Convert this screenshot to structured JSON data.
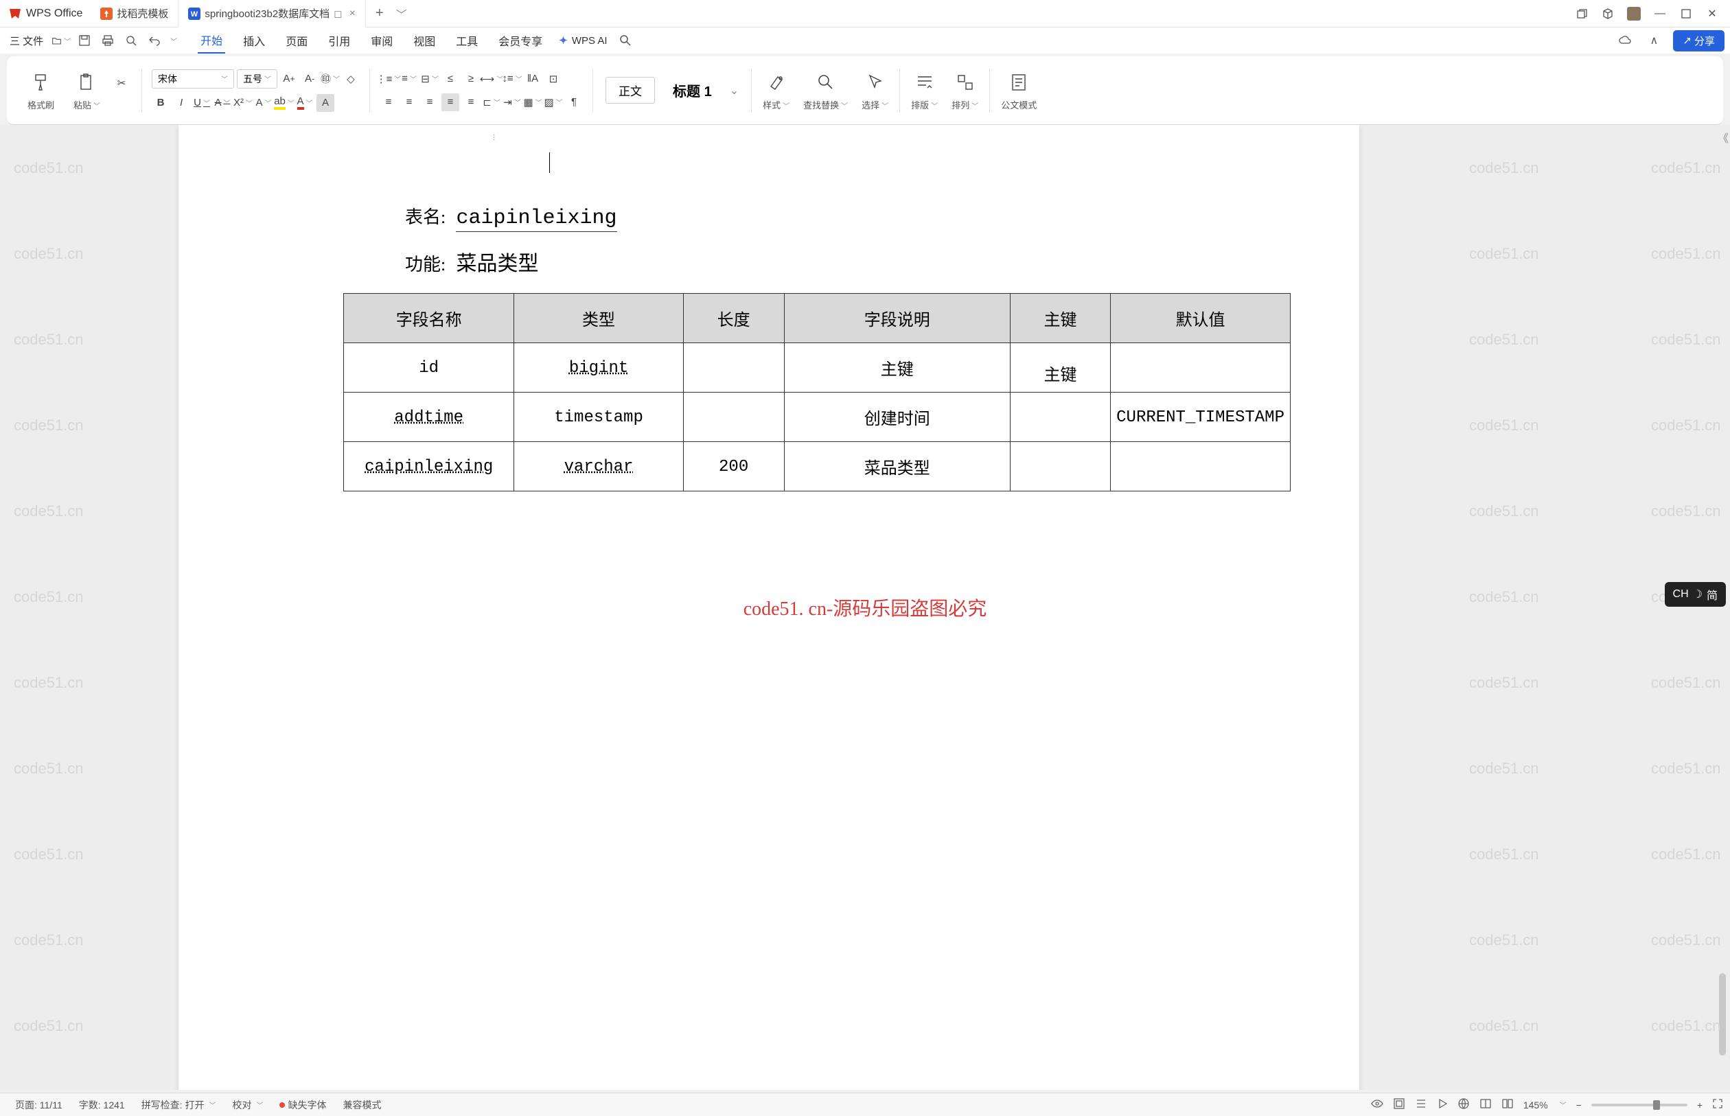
{
  "app": {
    "name": "WPS Office"
  },
  "tabs": [
    {
      "label": "找稻壳模板",
      "icon": "orange-doc"
    },
    {
      "label": "springbooti23b2数据库文档",
      "icon": "blue-w",
      "active": true
    }
  ],
  "tab_add": "+",
  "menubar": {
    "file": "三 文件",
    "items": [
      "开始",
      "插入",
      "页面",
      "引用",
      "审阅",
      "视图",
      "工具",
      "会员专享"
    ],
    "active": "开始",
    "wps_ai": "WPS AI",
    "share": "分享"
  },
  "ribbon": {
    "format_painter": "格式刷",
    "paste": "粘贴",
    "font_name": "宋体",
    "font_size": "五号",
    "style_normal": "正文",
    "style_heading": "标题 1",
    "style_panel": "样式",
    "find_replace": "查找替换",
    "select": "选择",
    "arrange_v": "排版",
    "arrange_h": "排列",
    "official": "公文模式"
  },
  "document": {
    "table_name_label": "表名:",
    "table_name_value": "caipinleixing",
    "function_label": "功能:",
    "function_value": "菜品类型",
    "headers": [
      "字段名称",
      "类型",
      "长度",
      "字段说明",
      "主键",
      "默认值"
    ],
    "rows": [
      {
        "name": "id",
        "type": "bigint",
        "length": "",
        "desc": "主键",
        "pk": "主键",
        "default": ""
      },
      {
        "name": "addtime",
        "type": "timestamp",
        "length": "",
        "desc": "创建时间",
        "pk": "",
        "default": "CURRENT_TIMESTAMP"
      },
      {
        "name": "caipinleixing",
        "type": "varchar",
        "length": "200",
        "desc": "菜品类型",
        "pk": "",
        "default": ""
      }
    ],
    "center_watermark": "code51. cn-源码乐园盗图必究",
    "watermark_text": "code51.cn"
  },
  "statusbar": {
    "page": "页面: 11/11",
    "words": "字数: 1241",
    "spellcheck": "拼写检查: 打开",
    "proof": "校对",
    "missing_font": "缺失字体",
    "compat": "兼容模式",
    "zoom": "145%"
  },
  "ime": {
    "label": "CH",
    "mode": "简"
  }
}
